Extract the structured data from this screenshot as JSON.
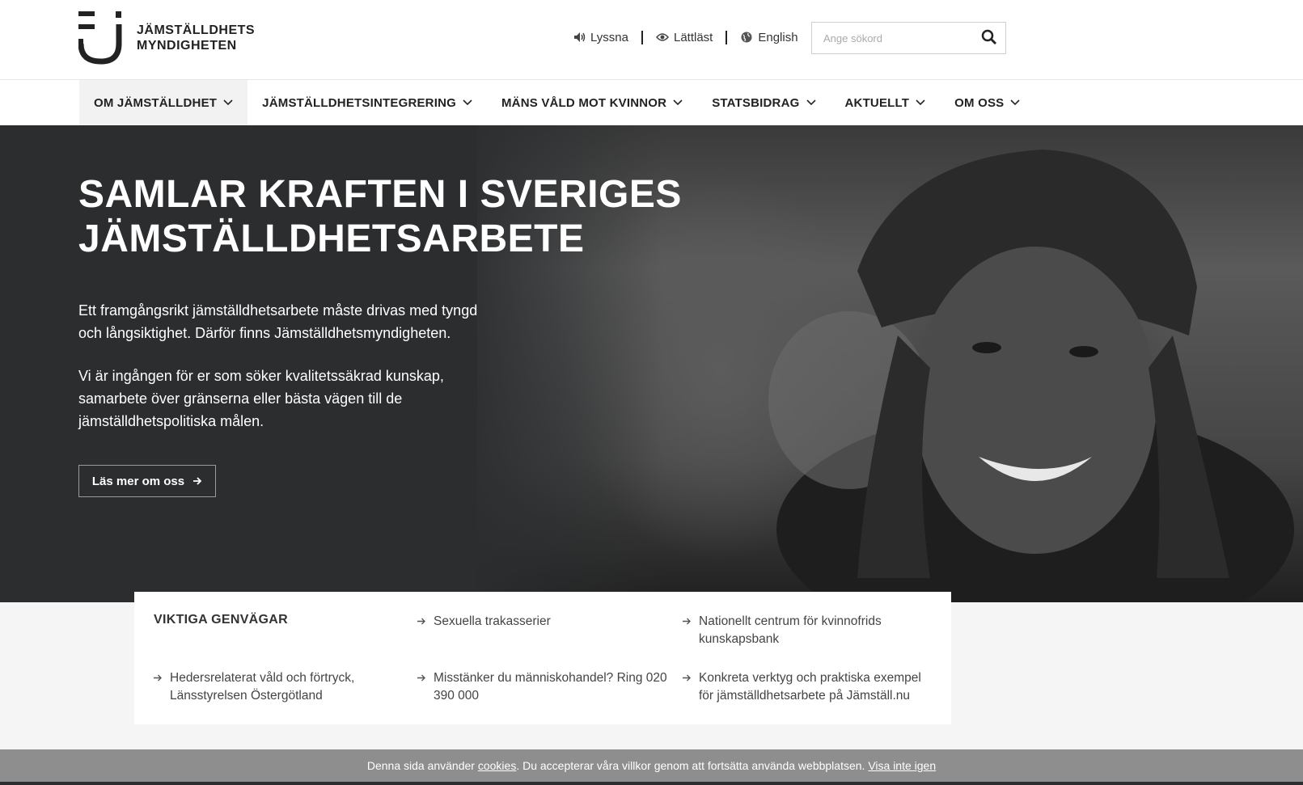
{
  "brand": {
    "line1": "JÄMSTÄLLDHETS",
    "line2": "MYNDIGHETEN"
  },
  "utilities": [
    {
      "label": "Lyssna",
      "icon": "speaker-icon"
    },
    {
      "label": "Lättläst",
      "icon": "eye-icon"
    },
    {
      "label": "English",
      "icon": "globe-icon"
    }
  ],
  "search": {
    "placeholder": "Ange sökord",
    "value": ""
  },
  "nav": {
    "items": [
      {
        "label": "OM JÄMSTÄLLDHET"
      },
      {
        "label": "JÄMSTÄLLDHETSINTEGRERING"
      },
      {
        "label": "MÄNS VÅLD MOT KVINNOR"
      },
      {
        "label": "STATSBIDRAG"
      },
      {
        "label": "AKTUELLT"
      },
      {
        "label": "OM OSS"
      }
    ]
  },
  "hero": {
    "title_line1": "SAMLAR KRAFTEN I SVERIGES",
    "title_line2": "JÄMSTÄLLDHETSARBETE",
    "paragraph1": "Ett framgångsrikt jämställdhetsarbete måste drivas med tyngd och långsiktighet. Därför finns Jämställdhetsmyndigheten.",
    "paragraph2": "Vi är ingången för er som söker kvalitetssäkrad kunskap, samarbete över gränserna eller bästa vägen till de jämställdhetspolitiska målen.",
    "button": "Läs mer om oss"
  },
  "shortcuts": {
    "heading": "VIKTIGA GENVÄGAR",
    "links": [
      "Sexuella trakasserier",
      "Nationellt centrum för kvinnofrids kunskapsbank",
      "Hedersrelaterat våld och förtryck, Länsstyrelsen Östergötland",
      "Misstänker du människohandel? Ring 020 390 000",
      "Konkreta verktyg och praktiska exempel för jämställdhetsarbete på Jämställ.nu"
    ]
  },
  "cookie": {
    "text_before": "Denna sida använder ",
    "link_cookies": "cookies",
    "text_after": ". Du accepterar våra villkor genom att fortsätta använda webbplatsen. ",
    "link_hide": "Visa inte igen"
  },
  "colors": {
    "hero_bg": "#2b2d2f",
    "cookie_bg": "#8e8e8e",
    "text_dark": "#222222"
  }
}
